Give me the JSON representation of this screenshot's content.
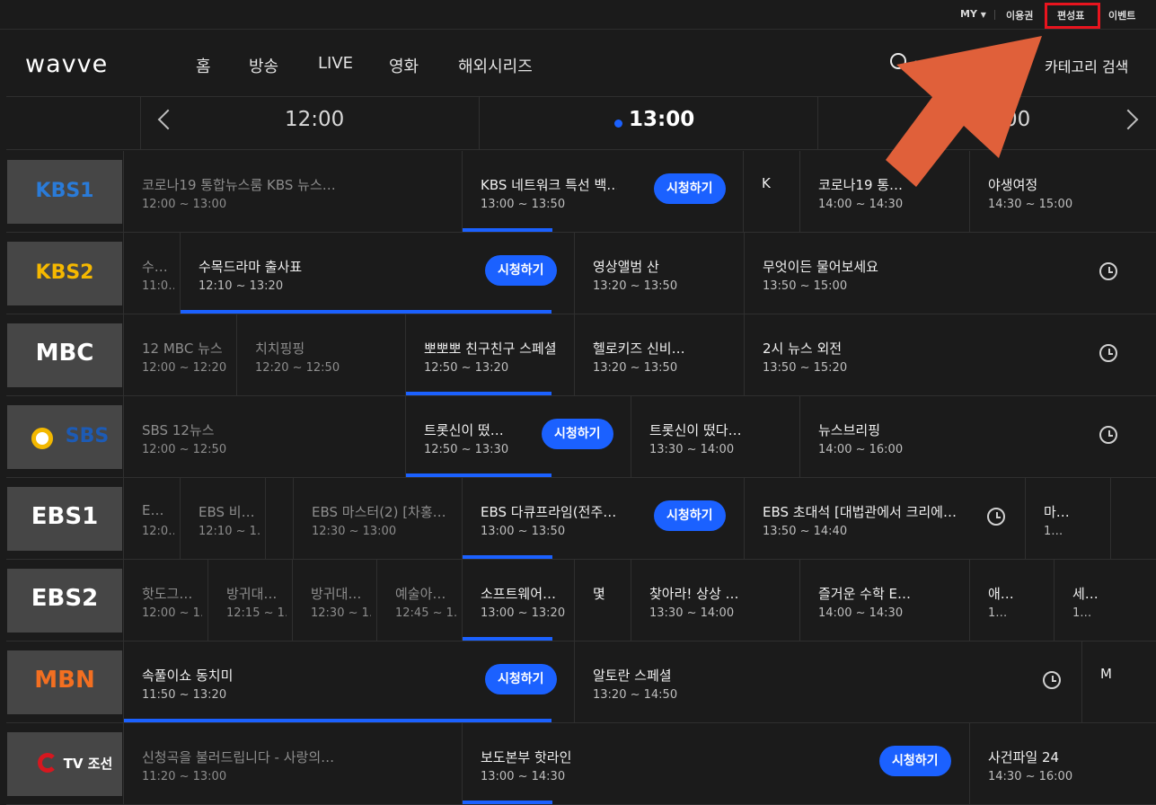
{
  "util": {
    "my": "MY",
    "my_chevron": "chevron-down",
    "pass": "이용권",
    "schedule": "편성표",
    "event": "이벤트"
  },
  "brand": "wavve",
  "nav": [
    "홈",
    "방송",
    "LIVE",
    "영화",
    "해외시리즈"
  ],
  "search": {
    "placeholder": "검색"
  },
  "category": "카테고리 검색",
  "times": {
    "t1": "12:00",
    "t2": "13:00",
    "t3": "14:00"
  },
  "watch_label": "시청하기",
  "colors": {
    "accent": "#1b61ff",
    "highlight": "#e8141e",
    "arrow": "#e0603a"
  },
  "channels": [
    {
      "logo": "KBS1",
      "programs": [
        {
          "title": "코로나19 통합뉴스룸 KBS 뉴스…",
          "time": "12:00 ~ 13:00"
        },
        {
          "title": "KBS 네트워크 특선 백…",
          "time": "13:00 ~ 13:50"
        },
        {
          "title": "K",
          "time": ""
        },
        {
          "title": "코로나19 통…",
          "time": "14:00 ~ 14:30"
        },
        {
          "title": "야생여정",
          "time": "14:30 ~ 15:00"
        }
      ]
    },
    {
      "logo": "KBS2",
      "programs": [
        {
          "title": "수…",
          "time": "11:0…"
        },
        {
          "title": "수목드라마 출사표",
          "time": "12:10 ~ 13:20"
        },
        {
          "title": "영상앨범 산",
          "time": "13:20 ~ 13:50"
        },
        {
          "title": "무엇이든 물어보세요",
          "time": "13:50 ~ 15:00"
        }
      ]
    },
    {
      "logo": "MBC",
      "programs": [
        {
          "title": "12 MBC 뉴스",
          "time": "12:00 ~ 12:20"
        },
        {
          "title": "치치핑핑",
          "time": "12:20 ~ 12:50"
        },
        {
          "title": "뽀뽀뽀 친구친구 스페셜",
          "time": "12:50 ~ 13:20"
        },
        {
          "title": "헬로키즈 신비…",
          "time": "13:20 ~ 13:50"
        },
        {
          "title": "2시 뉴스 외전",
          "time": "13:50 ~ 15:20"
        }
      ]
    },
    {
      "logo": "SBS",
      "programs": [
        {
          "title": "SBS 12뉴스",
          "time": "12:00 ~ 12:50"
        },
        {
          "title": "트롯신이 떴…",
          "time": "12:50 ~ 13:30"
        },
        {
          "title": "트롯신이 떴다…",
          "time": "13:30 ~ 14:00"
        },
        {
          "title": "뉴스브리핑",
          "time": "14:00 ~ 16:00"
        }
      ]
    },
    {
      "logo": "EBS1",
      "programs": [
        {
          "title": "E…",
          "time": "12:0…"
        },
        {
          "title": "EBS 비…",
          "time": "12:10 ~ 1…"
        },
        {
          "title": "",
          "time": ""
        },
        {
          "title": "EBS 마스터(2) [차홍…",
          "time": "12:30 ~ 13:00"
        },
        {
          "title": "EBS 다큐프라임(전주…",
          "time": "13:00 ~ 13:50"
        },
        {
          "title": "EBS 초대석 [대법관에서 크리에…",
          "time": "13:50 ~ 14:40"
        },
        {
          "title": "마…",
          "time": "1…"
        }
      ]
    },
    {
      "logo": "EBS2",
      "programs": [
        {
          "title": "핫도그…",
          "time": "12:00 ~ 1…"
        },
        {
          "title": "방귀대…",
          "time": "12:15 ~ 1…"
        },
        {
          "title": "방귀대…",
          "time": "12:30 ~ 1…"
        },
        {
          "title": "예술아…",
          "time": "12:45 ~ 1…"
        },
        {
          "title": "소프트웨어…",
          "time": "13:00 ~ 13:20"
        },
        {
          "title": "몇",
          "time": ""
        },
        {
          "title": "찾아라! 상상 …",
          "time": "13:30 ~ 14:00"
        },
        {
          "title": "즐거운 수학 E…",
          "time": "14:00 ~ 14:30"
        },
        {
          "title": "애…",
          "time": "1…"
        },
        {
          "title": "세…",
          "time": "1…"
        }
      ]
    },
    {
      "logo": "MBN",
      "programs": [
        {
          "title": "속풀이쇼 동치미",
          "time": "11:50 ~ 13:20"
        },
        {
          "title": "알토란 스페셜",
          "time": "13:20 ~ 14:50"
        },
        {
          "title": "M",
          "time": ""
        }
      ]
    },
    {
      "logo": "TV 조선",
      "programs": [
        {
          "title": "신청곡을 불러드립니다 - 사랑의…",
          "time": "11:20 ~ 13:00"
        },
        {
          "title": "보도본부 핫라인",
          "time": "13:00 ~ 14:30"
        },
        {
          "title": "사건파일 24",
          "time": "14:30 ~ 16:00"
        }
      ]
    }
  ]
}
